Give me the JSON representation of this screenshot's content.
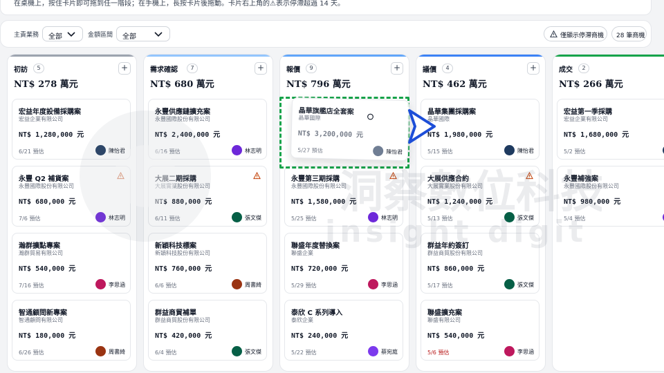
{
  "hint": "在桌機上，按住卡片即可拖到任一階段；在手機上，長按卡片後拖動。卡片右上角的⚠表示停滯超過 14 天。",
  "filters": {
    "owner_label": "主責業務",
    "owner_value": "全部",
    "amount_label": "金額區間",
    "amount_value": "全部",
    "stalled_only_label": "僅顯示停滯商機",
    "count_label": "28 筆商機"
  },
  "colors": {
    "stage_initial": "#9ca3af",
    "stage_needs": "#93c5fd",
    "stage_quote": "#60a5fa",
    "stage_negotiate": "#3b82f6",
    "stage_won": "#16a34a",
    "drop_outline": "#16a34a",
    "arrow": "#1d4ed8"
  },
  "columns": [
    {
      "title": "初訪",
      "count": "5",
      "total": "NT$ 278 萬元",
      "cards": [
        {
          "title": "宏益年度設備採購案",
          "company": "宏益企業有限公司",
          "amount": "NT$ 1,280,000 元",
          "date": "6/21 預估",
          "owner": "陳怡君",
          "avatar": "#1e3a5f"
        },
        {
          "title": "永豐 Q2 補貨案",
          "company": "永豐國際股份有限公司",
          "amount": "NT$ 680,000 元",
          "date": "7/6 預估",
          "owner": "林志明",
          "avatar": "#6d28d9",
          "warn": true
        },
        {
          "title": "瀚群擴點專案",
          "company": "瀚群貿易有限公司",
          "amount": "NT$ 540,000 元",
          "date": "7/16 預估",
          "owner": "李思涵",
          "avatar": "#be185d"
        },
        {
          "title": "智通顧問新專案",
          "company": "智通顧問有限公司",
          "amount": "NT$ 180,000 元",
          "date": "6/26 預估",
          "owner": "周書綺",
          "avatar": "#9a3412"
        }
      ]
    },
    {
      "title": "需求確認",
      "count": "7",
      "total": "NT$ 680 萬元",
      "cards": [
        {
          "title": "永豐供應鏈擴充案",
          "company": "永豐國際股份有限公司",
          "amount": "NT$ 2,400,000 元",
          "date": "6/16 預估",
          "owner": "林志明",
          "avatar": "#6d28d9"
        },
        {
          "title": "大展二期採購",
          "company": "大展實業股份有限公司",
          "amount": "NT$ 880,000 元",
          "date": "6/11 預估",
          "owner": "張文傑",
          "avatar": "#065f46",
          "warn": true
        },
        {
          "title": "新穎科技標案",
          "company": "新穎科技股份有限公司",
          "amount": "NT$ 760,000 元",
          "date": "6/6 預估",
          "owner": "周書綺",
          "avatar": "#9a3412"
        },
        {
          "title": "群益商貿補單",
          "company": "群益商貿股份有限公司",
          "amount": "NT$ 420,000 元",
          "date": "6/4 預估",
          "owner": "張文傑",
          "avatar": "#065f46"
        }
      ]
    },
    {
      "title": "報價",
      "count": "9",
      "total": "NT$ 796 萬元",
      "cards": [
        {
          "title": "永豐第三期採購",
          "company": "永豐國際股份有限公司",
          "amount": "NT$ 1,580,000 元",
          "date": "5/25 預估",
          "owner": "林志明",
          "avatar": "#6d28d9",
          "warn": true
        },
        {
          "title": "聯盛年度替換案",
          "company": "聯盛企業",
          "amount": "NT$ 720,000 元",
          "date": "5/29 預估",
          "owner": "李思涵",
          "avatar": "#be185d"
        },
        {
          "title": "泰欣 C 系列導入",
          "company": "泰欣企業",
          "amount": "NT$ 240,000 元",
          "date": "5/22 預估",
          "owner": "蔡宛庭",
          "avatar": "#7c3aed"
        }
      ]
    },
    {
      "title": "議價",
      "count": "4",
      "total": "NT$ 462 萬元",
      "cards": [
        {
          "title": "晶華集團採購案",
          "company": "晶華國際",
          "amount": "NT$ 1,980,000 元",
          "date": "5/15 預估",
          "owner": "陳怡君",
          "avatar": "#1e3a5f"
        },
        {
          "title": "大展供應合約",
          "company": "大展實業股份有限公司",
          "amount": "NT$ 1,240,000 元",
          "date": "5/13 預估",
          "owner": "張文傑",
          "avatar": "#065f46",
          "warn": true
        },
        {
          "title": "群益年約簽訂",
          "company": "群益商貿股份有限公司",
          "amount": "NT$ 860,000 元",
          "date": "5/17 預估",
          "owner": "張文傑",
          "avatar": "#065f46"
        },
        {
          "title": "聯盛擴充案",
          "company": "聯盛有限公司",
          "amount": "NT$ 540,000 元",
          "date": "5/6 預估",
          "owner": "李思涵",
          "avatar": "#be185d",
          "overdue": true
        }
      ]
    },
    {
      "title": "成交",
      "count": "2",
      "total": "NT$ 266 萬元",
      "cards": [
        {
          "title": "宏益第一季採購",
          "company": "宏益企業有限公司",
          "amount": "NT$ 1,680,000 元",
          "date": "5/2 預估",
          "owner": "",
          "avatar": "#1e3a5f"
        },
        {
          "title": "永豐補強案",
          "company": "永豐國際股份有限公司",
          "amount": "NT$ 980,000 元",
          "date": "5/4 預估",
          "owner": "",
          "avatar": "#6d28d9"
        }
      ]
    }
  ],
  "dragging": {
    "title": "晶華旗艦店全套案",
    "company": "晶華國際",
    "amount": "NT$ 3,200,000 元",
    "date": "5/27 預估",
    "owner": "陳怡君",
    "avatar": "#1e3a5f"
  },
  "watermark": {
    "cn": "洞察數位科技",
    "en": "insight digit"
  }
}
